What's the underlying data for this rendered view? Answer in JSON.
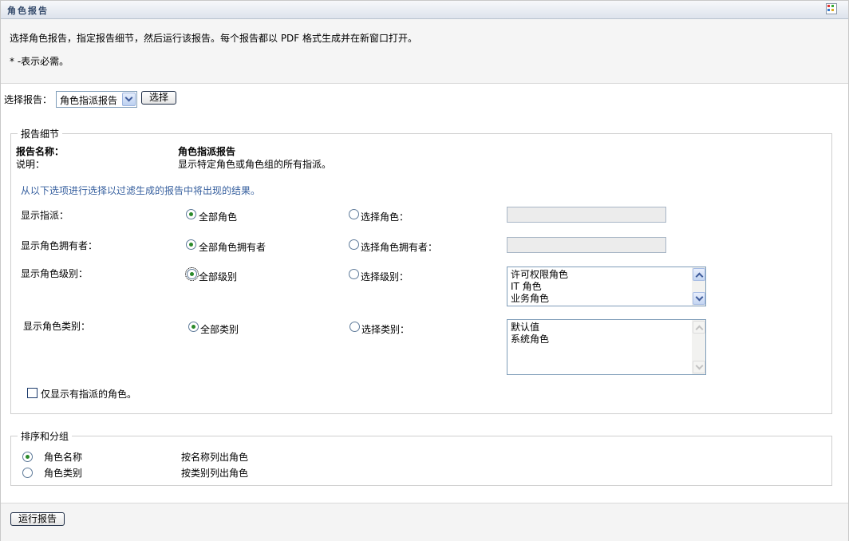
{
  "page": {
    "title": "角色报告",
    "intro": "选择角色报告，指定报告细节，然后运行该报告。每个报告都以 PDF 格式生成并在新窗口打开。",
    "required_note": "* -表示必需。"
  },
  "report_select": {
    "label": "选择报告：",
    "value": "角色指派报告",
    "button": "选择"
  },
  "details": {
    "legend": "报告细节",
    "name_label": "报告名称：",
    "name_value": "角色指派报告",
    "desc_label": "说明：",
    "desc_value": "显示特定角色或角色组的所有指派。",
    "filter_hint": "从以下选项进行选择以过滤生成的报告中将出现的结果。",
    "rows": [
      {
        "label": "显示指派：",
        "all": "全部角色",
        "select": "选择角色：",
        "all_selected": true
      },
      {
        "label": "显示角色拥有者：",
        "all": "全部角色拥有者",
        "select": "选择角色拥有者：",
        "all_selected": true
      },
      {
        "label": "显示角色级别：",
        "all": "全部级别",
        "select": "选择级别：",
        "all_selected": true,
        "options": [
          "许可权限角色",
          "IT 角色",
          "业务角色"
        ]
      },
      {
        "label": "显示角色类别：",
        "all": "全部类别",
        "select": "选择类别：",
        "all_selected": true,
        "options": [
          "默认值",
          "系统角色"
        ]
      }
    ],
    "only_assigned": {
      "label": "仅显示有指派的角色。",
      "checked": false
    }
  },
  "sort": {
    "legend": "排序和分组",
    "options": [
      {
        "label": "角色名称",
        "desc": "按名称列出角色",
        "selected": true
      },
      {
        "label": "角色类别",
        "desc": "按类别列出角色",
        "selected": false
      }
    ]
  },
  "footer": {
    "run_button": "运行报告"
  },
  "colors": {
    "hint_text": "#365f9e",
    "radio_dot": "#2b8a2b",
    "title_text": "#33496a"
  },
  "icons": [
    "grid-menu-icon",
    "chevron-down-icon",
    "chevron-up-icon"
  ]
}
